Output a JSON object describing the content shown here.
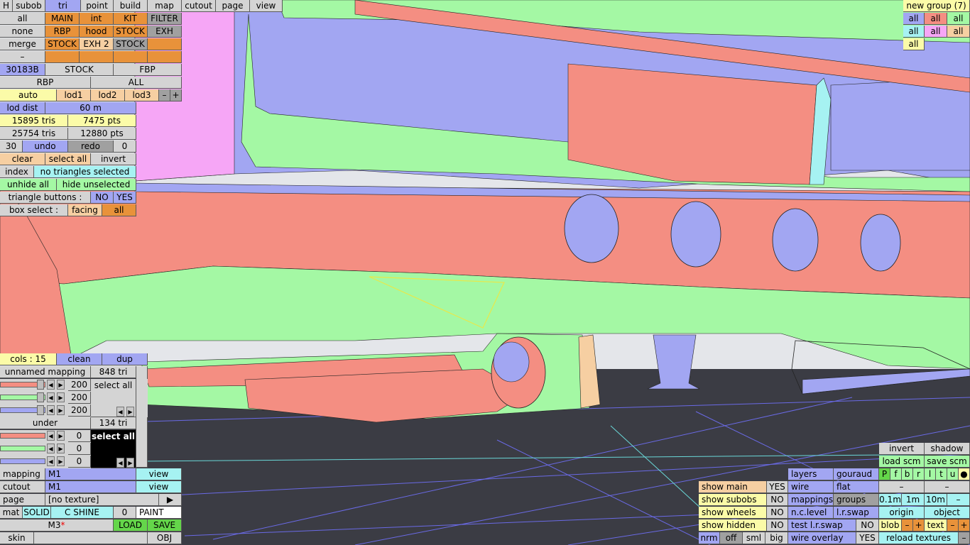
{
  "top_tabs": {
    "h": "H",
    "subob": "subob",
    "tri": "tri",
    "point": "point",
    "build": "build",
    "map": "map",
    "cutout": "cutout",
    "page": "page",
    "view": "view"
  },
  "groups": {
    "row1": [
      "all",
      "MAIN",
      "int",
      "KIT",
      "FILTER"
    ],
    "row2": [
      "none",
      "RBP",
      "hood",
      "STOCK",
      "EXH"
    ],
    "row3": [
      "merge",
      "STOCK",
      "EXH 2",
      "STOCK",
      ""
    ],
    "row4": [
      "–",
      "",
      "",
      "",
      ""
    ]
  },
  "info": {
    "id": "30183B",
    "stock": "STOCK",
    "fbp": "FBP",
    "rbp": "RBP",
    "all": "ALL",
    "lods": [
      "auto",
      "lod1",
      "lod2",
      "lod3"
    ],
    "minus": "–",
    "plus": "+",
    "lod_dist_label": "lod dist",
    "lod_dist_value": "60 m",
    "tris1": "15895 tris",
    "pts1": "7475 pts",
    "tris2": "25754 tris",
    "pts2": "12880 pts",
    "undo_count": "30",
    "undo": "undo",
    "redo": "redo",
    "redo_count": "0",
    "clear": "clear",
    "select_all": "select all",
    "invert": "invert",
    "index": "index",
    "no_sel": "no triangles selected",
    "unhide_all": "unhide all",
    "hide_unselected": "hide unselected",
    "tri_buttons": "triangle buttons :",
    "no": "NO",
    "yes": "YES",
    "box_select": "box select :",
    "facing": "facing",
    "all2": "all"
  },
  "right_top": {
    "new_group": "new group (7)",
    "rows": [
      [
        "all",
        "all",
        "all"
      ],
      [
        "all",
        "all",
        "all"
      ],
      [
        "all"
      ]
    ]
  },
  "mapping_panel": {
    "cols": "cols : 15",
    "clean": "clean",
    "dup": "dup",
    "unnamed": "unnamed mapping",
    "tri848": "848 tri",
    "val200a": "200",
    "val200b": "200",
    "val200c": "200",
    "select_all": "select all",
    "under": "under",
    "tri134": "134 tri",
    "zero1": "0",
    "zero2": "0",
    "zero3": "0",
    "select_all_black": "select all",
    "mapping": "mapping",
    "m1a": "M1",
    "view1": "view",
    "cutout": "cutout",
    "m1b": "M1",
    "view2": "view",
    "page": "page",
    "no_texture": "[no texture]",
    "play": "▶",
    "mat": "mat",
    "solid": "SOLID",
    "cshine": "C SHINE",
    "zero": "0",
    "paint": "PAINT",
    "m3": "M3",
    "star": "*",
    "load": "LOAD",
    "save": "SAVE",
    "skin": "skin",
    "obj": "OBJ"
  },
  "bottom_mid": {
    "show_main": "show main",
    "yes1": "YES",
    "show_subobs": "show subobs",
    "no1": "NO",
    "show_wheels": "show wheels",
    "no2": "NO",
    "show_hidden": "show hidden",
    "no3": "NO",
    "nrm": "nrm",
    "off": "off",
    "sml": "sml",
    "big": "big"
  },
  "bottom_right": {
    "layers": "layers",
    "gouraud": "gouraud",
    "wire": "wire",
    "flat": "flat",
    "mappings": "mappings",
    "groups": "groups",
    "nclevel": "n.c.level",
    "lrswap": "l.r.swap",
    "test_lrswap": "test l.r.swap",
    "no4": "NO",
    "wire_overlay": "wire overlay",
    "yes2": "YES",
    "invert": "invert",
    "shadow": "shadow",
    "load_scm": "load scm",
    "save_scm": "save scm",
    "letters": [
      "P",
      "f",
      "b",
      "r",
      "l",
      "t",
      "u",
      "●"
    ],
    "dash1": "–",
    "dash2": "–",
    "d01": "0.1m",
    "d1": "1m",
    "d10": "10m",
    "dash3": "–",
    "origin": "origin",
    "object": "object",
    "blob": "blob",
    "bminus": "–",
    "bplus": "+",
    "text": "text",
    "tminus": "–",
    "tplus": "+",
    "reload": "reload textures",
    "dash4": "–"
  }
}
